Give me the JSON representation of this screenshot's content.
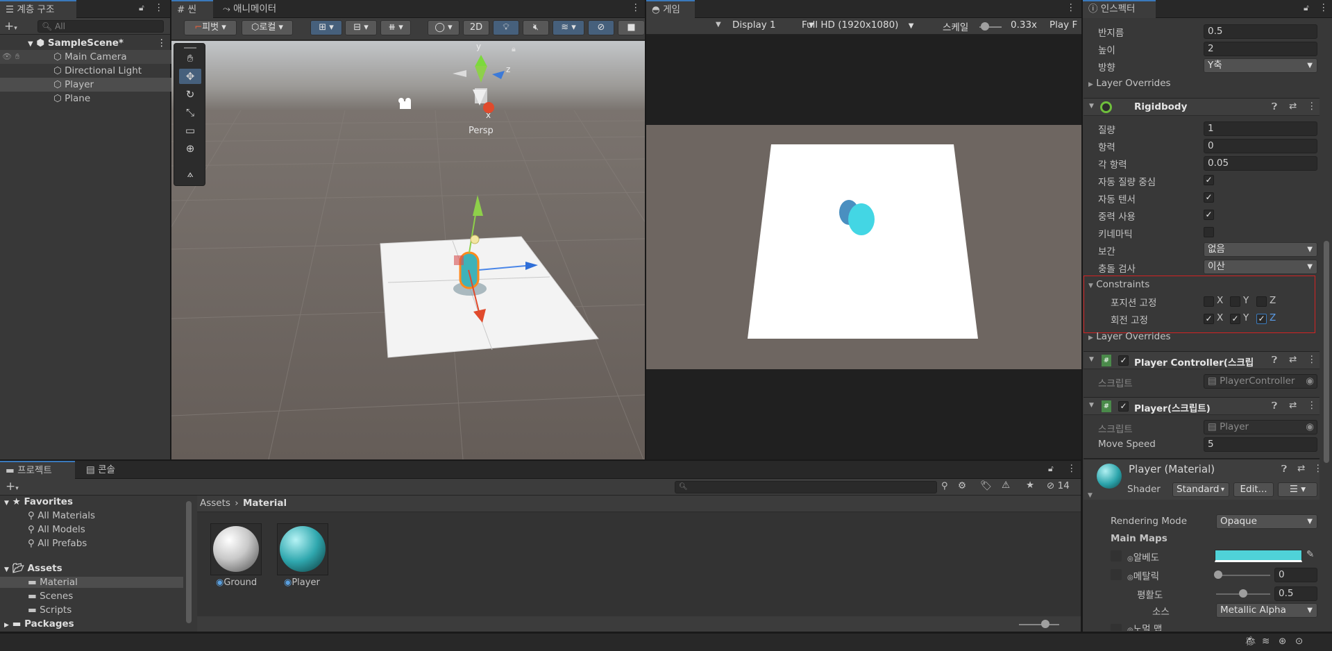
{
  "hierarchy": {
    "tab": "계층 구조",
    "search_placeholder": "All",
    "scene": "SampleScene*",
    "items": [
      "Main Camera",
      "Directional Light",
      "Player",
      "Plane"
    ]
  },
  "scene_view": {
    "tab_scene": "씬",
    "tab_animator": "애니메이터",
    "pivot": "피벗",
    "local": "로컬",
    "two_d": "2D",
    "persp": "Persp",
    "gizmo_y": "y",
    "gizmo_z": "z",
    "gizmo_x": "x"
  },
  "game_view": {
    "tab": "게임",
    "display": "Display 1",
    "resolution": "Full HD (1920x1080)",
    "scale_label": "스케일",
    "scale_value": "0.33x",
    "play": "Play F"
  },
  "inspector": {
    "tab": "인스펙터",
    "capsule": {
      "radius_label": "반지름",
      "radius": "0.5",
      "height_label": "높이",
      "height": "2",
      "dir_label": "방향",
      "dir": "Y축",
      "layer_overrides": "Layer Overrides"
    },
    "rigidbody": {
      "title": "Rigidbody",
      "mass_label": "질량",
      "mass": "1",
      "drag_label": "항력",
      "drag": "0",
      "angular_label": "각 항력",
      "angular": "0.05",
      "auto_com_label": "자동 질량 중심",
      "auto_tensor_label": "자동 텐서",
      "gravity_label": "중력 사용",
      "kinematic_label": "키네마틱",
      "interp_label": "보간",
      "interp": "없음",
      "collision_label": "충돌 검사",
      "collision": "이산",
      "constraints": "Constraints",
      "freeze_pos": "포지션 고정",
      "freeze_rot": "회전 고정",
      "x": "X",
      "y": "Y",
      "z": "Z",
      "layer_overrides": "Layer Overrides"
    },
    "player_controller": {
      "title": "Player Controller(스크립",
      "script_label": "스크립트",
      "script": "PlayerController"
    },
    "player": {
      "title": "Player(스크립트)",
      "script_label": "스크립트",
      "script": "Player",
      "speed_label": "Move Speed",
      "speed": "5"
    },
    "material": {
      "title": "Player (Material)",
      "shader_label": "Shader",
      "shader": "Standard",
      "edit": "Edit...",
      "rendering_label": "Rendering Mode",
      "rendering": "Opaque",
      "main_maps": "Main Maps",
      "albedo": "알베도",
      "metallic": "메탈릭",
      "metallic_value": "0",
      "smooth": "평활도",
      "smooth_value": "0.5",
      "source_label": "소스",
      "source": "Metallic Alpha",
      "normal": "노멀 맵",
      "albedo_color": "#4fd2d8"
    }
  },
  "project": {
    "tab_project": "프로젝트",
    "tab_console": "콘솔",
    "favorites": "Favorites",
    "fav_items": [
      "All Materials",
      "All Models",
      "All Prefabs"
    ],
    "assets": "Assets",
    "asset_folders": [
      "Material",
      "Scenes",
      "Scripts"
    ],
    "packages": "Packages",
    "breadcrumb_root": "Assets",
    "breadcrumb_current": "Material",
    "hidden_count": "14",
    "files": [
      "Ground",
      "Player"
    ]
  }
}
